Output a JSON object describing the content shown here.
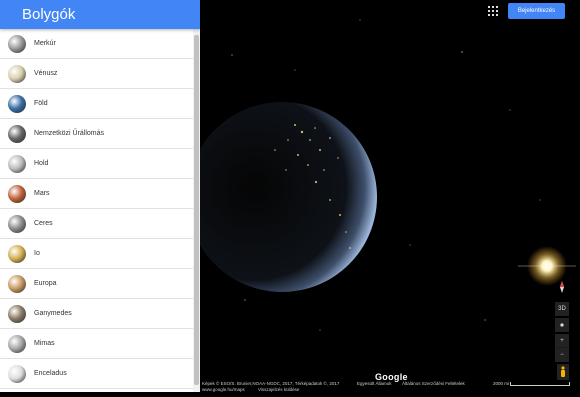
{
  "sidebar": {
    "title": "Bolygók",
    "items": [
      {
        "label": "Merkúr",
        "color": "#9a9a9a"
      },
      {
        "label": "Vénusz",
        "color": "#d9cfb0"
      },
      {
        "label": "Föld",
        "color": "#3a6ea5"
      },
      {
        "label": "Nemzetközi Űrállomás",
        "color": "#666666"
      },
      {
        "label": "Hold",
        "color": "#bdbdbd"
      },
      {
        "label": "Mars",
        "color": "#c1643b"
      },
      {
        "label": "Ceres",
        "color": "#8c8c8c"
      },
      {
        "label": "Io",
        "color": "#d6b054"
      },
      {
        "label": "Europa",
        "color": "#c99a62"
      },
      {
        "label": "Ganymedes",
        "color": "#8c7b66"
      },
      {
        "label": "Mimas",
        "color": "#a8a8a8"
      },
      {
        "label": "Enceladus",
        "color": "#dedede"
      }
    ]
  },
  "header": {
    "signin_label": "Bejelentkezés",
    "apps_icon": "apps-grid-icon"
  },
  "controls": {
    "compass_icon": "compass-icon",
    "view_3d": "3D",
    "zoom_in": "+",
    "zoom_out": "−"
  },
  "footer": {
    "attribution": "Képek © ESO/S. Brunier,NOAA-NGDC, 2017, Térképadatok ©, 2017",
    "country": "Egyesült Államok",
    "terms": "Általános Szerződési Feltételek",
    "url": "www.google.hu/maps",
    "feedback": "Visszajelzés küldése",
    "scale_label": "2000 mi"
  },
  "logo": "Google",
  "colors": {
    "accent": "#4285f4"
  }
}
